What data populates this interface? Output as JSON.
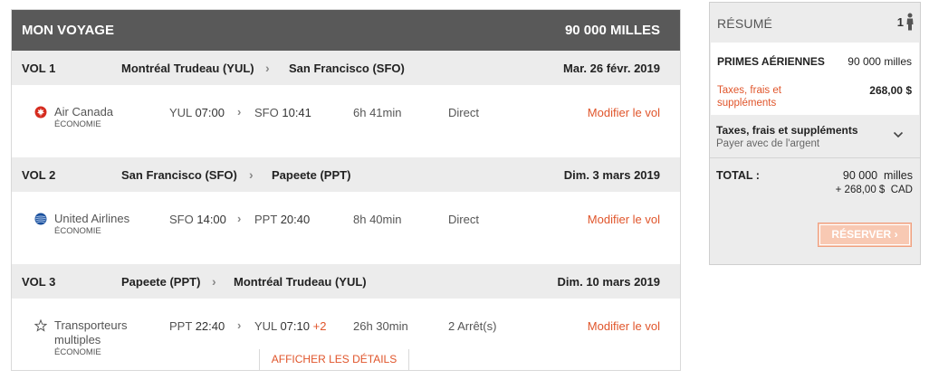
{
  "trip": {
    "title": "MON VOYAGE",
    "total_miles": "90 000 MILLES",
    "flights": [
      {
        "label": "VOL 1",
        "from": "Montréal Trudeau (YUL)",
        "to": "San Francisco (SFO)",
        "date": "Mar. 26 févr. 2019",
        "airline": "Air Canada",
        "airline_line2": "",
        "cabin": "ÉCONOMIE",
        "dep_code": "YUL",
        "dep_time": "07:00",
        "arr_code": "SFO",
        "arr_time": "10:41",
        "arr_plus": "",
        "duration": "6h 41min",
        "stops": "Direct",
        "modify": "Modifier le vol",
        "logo_icon": "air-canada-maple-leaf-icon"
      },
      {
        "label": "VOL 2",
        "from": "San Francisco (SFO)",
        "to": "Papeete (PPT)",
        "date": "Dim. 3 mars 2019",
        "airline": "United Airlines",
        "airline_line2": "",
        "cabin": "ÉCONOMIE",
        "dep_code": "SFO",
        "dep_time": "14:00",
        "arr_code": "PPT",
        "arr_time": "20:40",
        "arr_plus": "",
        "duration": "8h 40min",
        "stops": "Direct",
        "modify": "Modifier le vol",
        "logo_icon": "united-globe-icon"
      },
      {
        "label": "VOL 3",
        "from": "Papeete (PPT)",
        "to": "Montréal Trudeau (YUL)",
        "date": "Dim. 10 mars 2019",
        "airline": "Transporteurs",
        "airline_line2": "multiples",
        "cabin": "ÉCONOMIE",
        "dep_code": "PPT",
        "dep_time": "22:40",
        "arr_code": "YUL",
        "arr_time": "07:10",
        "arr_plus": "+2",
        "duration": "26h 30min",
        "stops": "2 Arrêt(s)",
        "modify": "Modifier le vol",
        "logo_icon": "star-alliance-icon"
      }
    ],
    "details_label": "AFFICHER LES DÉTAILS"
  },
  "summary": {
    "title": "RÉSUMÉ",
    "passengers": "1",
    "miles_label": "PRIMES AÉRIENNES",
    "miles_value": "90 000 milles",
    "taxes_label": "Taxes, frais et suppléments",
    "taxes_value": "268,00 $",
    "pay_title": "Taxes, frais et suppléments",
    "pay_subtitle": "Payer avec de l'argent",
    "total_label": "TOTAL :",
    "total_miles": "90 000  milles",
    "total_cash": "+ 268,00 $  CAD",
    "reserve_label": "RÉSERVER"
  },
  "colors": {
    "accent": "#e0552b",
    "header_bg": "#595959",
    "bar_bg": "#ececec"
  }
}
